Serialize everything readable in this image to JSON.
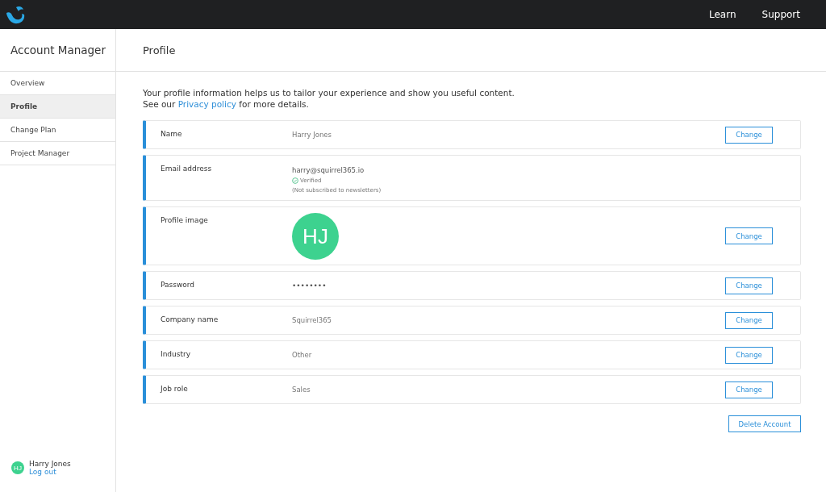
{
  "top_nav": {
    "links": [
      "Learn",
      "Support"
    ]
  },
  "sidebar": {
    "title": "Account Manager",
    "items": [
      {
        "label": "Overview",
        "selected": false
      },
      {
        "label": "Profile",
        "selected": true
      },
      {
        "label": "Change Plan",
        "selected": false
      },
      {
        "label": "Project Manager",
        "selected": false
      }
    ],
    "user": {
      "initials": "HJ",
      "name": "Harry Jones",
      "logout": "Log out"
    }
  },
  "page": {
    "title": "Profile",
    "intro_line1": "Your profile information helps us to tailor your experience and show you useful content.",
    "intro_before_link": "See our",
    "intro_link": "Privacy policy",
    "intro_after_link": "for more details."
  },
  "fields": [
    {
      "kind": "text",
      "label": "Name",
      "value": "Harry Jones",
      "button": "Change"
    },
    {
      "kind": "email",
      "label": "Email address",
      "value": "harry@squirrel365.io",
      "verified": "Verified",
      "note": "(Not subscribed to newsletters)"
    },
    {
      "kind": "avatar",
      "label": "Profile image",
      "value": "HJ",
      "button": "Change"
    },
    {
      "kind": "password",
      "label": "Password",
      "value": "••••••••",
      "button": "Change"
    },
    {
      "kind": "text",
      "label": "Company name",
      "value": "Squirrel365",
      "button": "Change"
    },
    {
      "kind": "text",
      "label": "Industry",
      "value": "Other",
      "button": "Change"
    },
    {
      "kind": "text",
      "label": "Job role",
      "value": "Sales",
      "button": "Change"
    }
  ],
  "delete_button": "Delete Account"
}
